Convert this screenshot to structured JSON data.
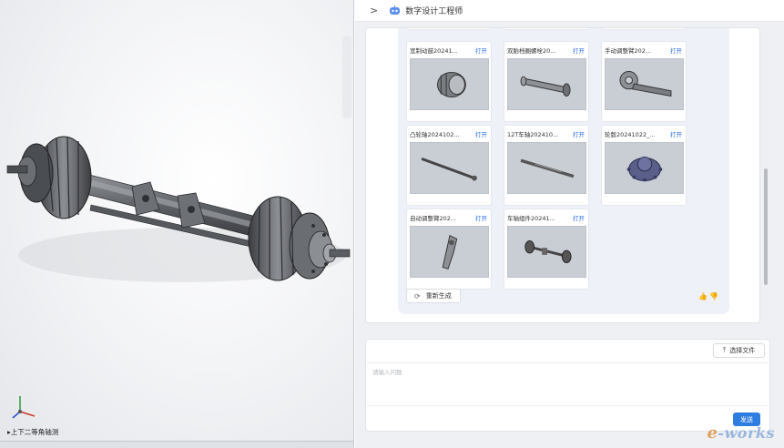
{
  "viewport": {
    "view_label": "上下二等角轴测",
    "icons": [
      "triad-axis-icon",
      "axle-model"
    ]
  },
  "header": {
    "chevron": ">",
    "title": "数字设计工程师",
    "icon": "robot-icon"
  },
  "results": {
    "open_label": "打开",
    "items": [
      {
        "name": "宽制动鼓20241...",
        "thumb": "drum-part"
      },
      {
        "name": "双胎档圈螺栓20...",
        "thumb": "bolt-part"
      },
      {
        "name": "手动调整臂202...",
        "thumb": "arm-part"
      },
      {
        "name": "凸轮轴2024102...",
        "thumb": "camshaft-part"
      },
      {
        "name": "12T车轴202410...",
        "thumb": "shaft-part"
      },
      {
        "name": "轮毂20241022_...",
        "thumb": "hub-part"
      },
      {
        "name": "自动调整臂202...",
        "thumb": "auto-arm-part"
      },
      {
        "name": "车轴组件20241...",
        "thumb": "axle-assembly-part"
      }
    ],
    "regenerate_label": "重新生成",
    "regenerate_icon": "refresh-icon",
    "like_icon": "thumbs-up-icon",
    "dislike_icon": "thumbs-down-icon"
  },
  "composer": {
    "upload_label": "选择文件",
    "upload_icon": "upload-icon",
    "placeholder": "请输入问题",
    "send_label": "发送"
  },
  "watermark": {
    "prefix": "e",
    "text": "-works"
  },
  "colors": {
    "accent": "#2f7de1",
    "link": "#2f6fe4",
    "card_bg": "#eef2f8"
  }
}
